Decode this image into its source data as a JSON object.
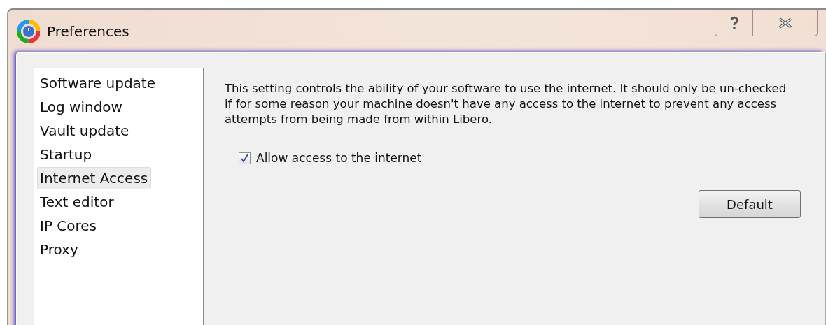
{
  "window": {
    "title": "Preferences"
  },
  "sidebar": {
    "items": [
      {
        "label": "Software update",
        "selected": false
      },
      {
        "label": "Log window",
        "selected": false
      },
      {
        "label": "Vault update",
        "selected": false
      },
      {
        "label": "Startup",
        "selected": false
      },
      {
        "label": "Internet Access",
        "selected": true
      },
      {
        "label": "Text editor",
        "selected": false
      },
      {
        "label": "IP Cores",
        "selected": false
      },
      {
        "label": "Proxy",
        "selected": false
      }
    ]
  },
  "panel": {
    "description": "This setting controls the ability of your software to use the internet.  It should only be un-checked if for some reason your machine doesn't have any access to the internet to prevent any access attempts from being made from within Libero.",
    "checkbox": {
      "label": "Allow access to the internet",
      "checked": true
    },
    "button": {
      "label": "Default"
    }
  }
}
